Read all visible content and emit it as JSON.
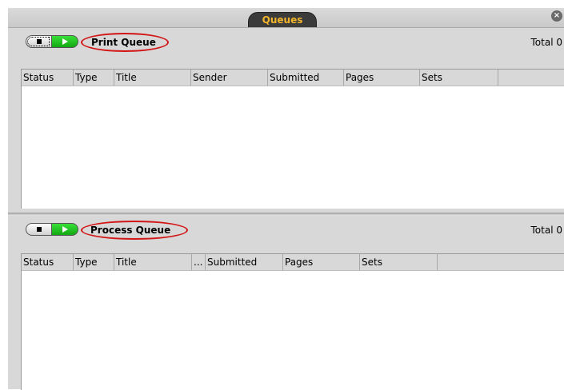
{
  "window": {
    "title": "Queues",
    "close_symbol": "×"
  },
  "print_queue": {
    "title": "Print Queue",
    "total": "Total 0",
    "columns": [
      "Status",
      "Type",
      "Title",
      "Sender",
      "Submitted",
      "Pages",
      "Sets"
    ]
  },
  "process_queue": {
    "title": "Process Queue",
    "total": "Total 0",
    "columns": [
      "Status",
      "Type",
      "Title",
      "...",
      "Submitted",
      "Pages",
      "Sets"
    ]
  },
  "icons": {
    "stop": "stop-icon",
    "play": "play-icon",
    "close": "close-icon"
  },
  "colors": {
    "title_tab_text": "#f3b52b",
    "title_tab_bg": "#3b3b3b",
    "play_green": "#22c422",
    "highlight_oval": "#d31515",
    "panel_bg": "#d8d8d8"
  }
}
